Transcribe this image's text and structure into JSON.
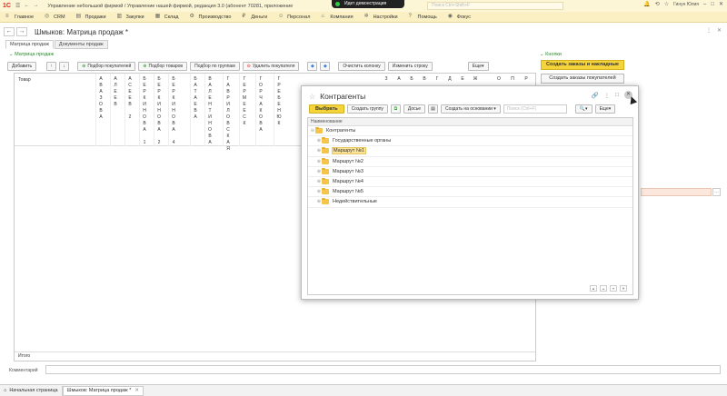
{
  "titlebar": {
    "app_title": "Управление небольшой фирмой / Управление нашей фирмой, редакция 3.0 (абонент 70281, приложение 394789) (1С:Предприятие)",
    "demo_label": "Идет демонстрация",
    "search_placeholder": "Поиск Ctrl+Shift+F",
    "user": "Гинун Юлия"
  },
  "sections": [
    {
      "icon": "home-icon",
      "label": "Главное"
    },
    {
      "icon": "crm-icon",
      "label": "CRM"
    },
    {
      "icon": "sales-icon",
      "label": "Продажи"
    },
    {
      "icon": "purchases-icon",
      "label": "Закупки"
    },
    {
      "icon": "warehouse-icon",
      "label": "Склад"
    },
    {
      "icon": "production-icon",
      "label": "Производство"
    },
    {
      "icon": "money-icon",
      "label": "Деньги"
    },
    {
      "icon": "staff-icon",
      "label": "Персонал"
    },
    {
      "icon": "company-icon",
      "label": "Компания"
    },
    {
      "icon": "settings-icon",
      "label": "Настройки"
    },
    {
      "icon": "help-icon",
      "label": "Помощь"
    },
    {
      "icon": "focus-icon",
      "label": "Фокус"
    }
  ],
  "form": {
    "title": "Шмыков: Матрица продаж *",
    "tabs": [
      "Матрица продаж",
      "Документы продаж"
    ],
    "group_left": "Матрица продаж",
    "group_right": "Кнопки"
  },
  "toolbar": {
    "add": "Добавить",
    "pick_buyers": "Подбор покупателей",
    "pick_goods": "Подбор товаров",
    "pick_groups": "Подбор по группам",
    "delete_buyer": "Удалить покупателя",
    "clear_column": "Очистить колонку",
    "change_row": "Изменить строку",
    "more": "Еще"
  },
  "matrix": {
    "total_label": "Товар",
    "footer_total": "Итого",
    "columns": [
      "АВАЗОВА",
      "АЛЕЕВ",
      "АСЕЕВ 2",
      "БЕРКИНОВА 1",
      "БЕРКИНОВА 2",
      "БЕРКИНОВА 4",
      "БАТАЕВА",
      "ВАЛЕНТИНОВА",
      "ГАВРИЛОВСКАЯ",
      "ГЕРМЕЕСК",
      "ГОРЧАКОВА",
      "ГРЕБЕНЮК"
    ],
    "right_columns": [
      "З",
      "А",
      "Б",
      "В",
      "Г",
      "Д",
      "Е",
      "Ж",
      "О",
      "П",
      "Р"
    ]
  },
  "right_buttons": {
    "create_orders": "Создать заказы и накладные",
    "create_buyer_orders": "Создать заказы покупателей"
  },
  "comment_label": "Комментарий",
  "bottom_tabs": [
    {
      "icon": "home-icon",
      "label": "Начальная страница"
    },
    {
      "label": "Шмыков: Матрица продаж *"
    }
  ],
  "modal": {
    "title": "Контрагенты",
    "select": "Выбрать",
    "create_group": "Создать группу",
    "dossier": "Досье",
    "create_based": "Создать на основании",
    "search_placeholder": "Поиск (Ctrl+F)",
    "more": "Еще",
    "column_header": "Наименование",
    "root": "Контрагенты",
    "rows": [
      {
        "label": "Государственные органы",
        "selected": false
      },
      {
        "label": "Маршрут №1",
        "selected": true
      },
      {
        "label": "Маршрут №2",
        "selected": false
      },
      {
        "label": "Маршрут №3",
        "selected": false
      },
      {
        "label": "Маршрут №4",
        "selected": false
      },
      {
        "label": "Маршрут №5",
        "selected": false
      },
      {
        "label": "Недействительные",
        "selected": false
      }
    ]
  }
}
